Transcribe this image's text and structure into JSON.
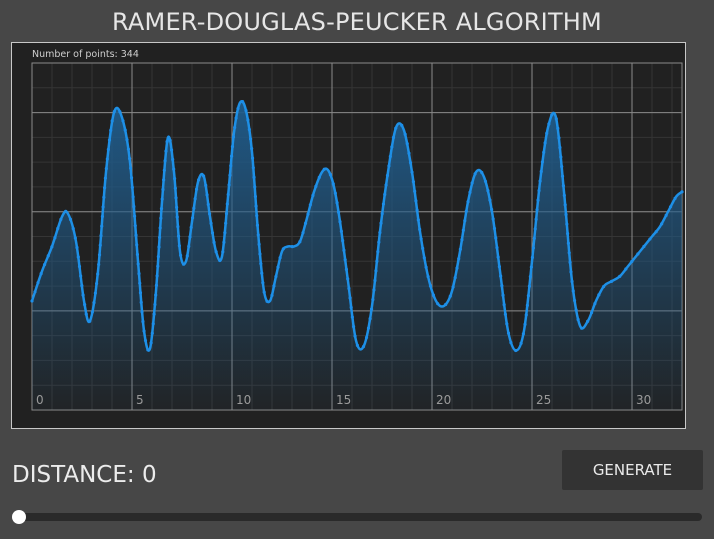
{
  "title": "RAMER-DOUGLAS-PEUCKER ALGORITHM",
  "points_label": "Number of points: 344",
  "distance_label": "DISTANCE: 0",
  "generate_label": "GENERATE",
  "slider": {
    "value": 0
  },
  "colors": {
    "background": "#474747",
    "plot_background": "#212121",
    "curve": "#1e90e6",
    "fill_top": "#1f5c8c",
    "grid_major": "#8a8a8a",
    "grid_minor": "#353535",
    "tick_label": "#9a9a9a"
  },
  "chart_data": {
    "type": "area",
    "title": "",
    "xlabel": "",
    "ylabel": "",
    "xlim": [
      0,
      32.5
    ],
    "ylim": [
      -1,
      2.5
    ],
    "xticks": [
      "0",
      "5",
      "10",
      "15",
      "20",
      "25",
      "30"
    ],
    "xtick_values": [
      0,
      5,
      10,
      15,
      20,
      25,
      30
    ],
    "grid": true,
    "num_points": 344,
    "series": [
      {
        "x": [
          0,
          0.5,
          1.0,
          1.5,
          1.8,
          2.2,
          2.6,
          2.9,
          3.3,
          3.7,
          4.1,
          4.5,
          4.9,
          5.3,
          5.6,
          5.9,
          6.2,
          6.5,
          6.8,
          7.1,
          7.4,
          7.7,
          8.0,
          8.3,
          8.6,
          8.9,
          9.2,
          9.5,
          9.8,
          10.1,
          10.4,
          10.7,
          11.0,
          11.3,
          11.6,
          11.9,
          12.2,
          12.5,
          12.8,
          13.1,
          13.4,
          13.7,
          14.1,
          14.5,
          14.8,
          15.1,
          15.4,
          15.8,
          16.2,
          16.6,
          17.0,
          17.4,
          17.8,
          18.2,
          18.6,
          19.0,
          19.4,
          19.8,
          20.2,
          20.6,
          21.0,
          21.4,
          21.8,
          22.2,
          22.6,
          23.0,
          23.4,
          23.8,
          24.2,
          24.6,
          25.0,
          25.4,
          25.8,
          26.2,
          26.6,
          27.0,
          27.4,
          27.8,
          28.2,
          28.6,
          29.0,
          29.4,
          29.8,
          30.2,
          30.6,
          31.0,
          31.4,
          31.8,
          32.2,
          32.5
        ],
        "y": [
          0.1,
          0.4,
          0.65,
          0.95,
          0.98,
          0.7,
          0.1,
          -0.1,
          0.4,
          1.4,
          2.0,
          1.95,
          1.5,
          0.5,
          -0.2,
          -0.38,
          0.2,
          1.1,
          1.75,
          1.4,
          0.6,
          0.5,
          0.9,
          1.3,
          1.35,
          0.95,
          0.6,
          0.55,
          1.15,
          1.8,
          2.1,
          2.02,
          1.6,
          0.8,
          0.2,
          0.1,
          0.35,
          0.6,
          0.65,
          0.65,
          0.7,
          0.9,
          1.2,
          1.4,
          1.42,
          1.25,
          0.9,
          0.3,
          -0.3,
          -0.35,
          0.05,
          0.8,
          1.4,
          1.85,
          1.82,
          1.4,
          0.8,
          0.35,
          0.1,
          0.05,
          0.2,
          0.6,
          1.1,
          1.4,
          1.35,
          1.0,
          0.4,
          -0.2,
          -0.4,
          -0.2,
          0.5,
          1.3,
          1.85,
          1.95,
          1.2,
          0.3,
          -0.15,
          -0.1,
          0.1,
          0.25,
          0.3,
          0.35,
          0.45,
          0.55,
          0.65,
          0.75,
          0.85,
          1.0,
          1.15,
          1.2
        ]
      }
    ]
  }
}
